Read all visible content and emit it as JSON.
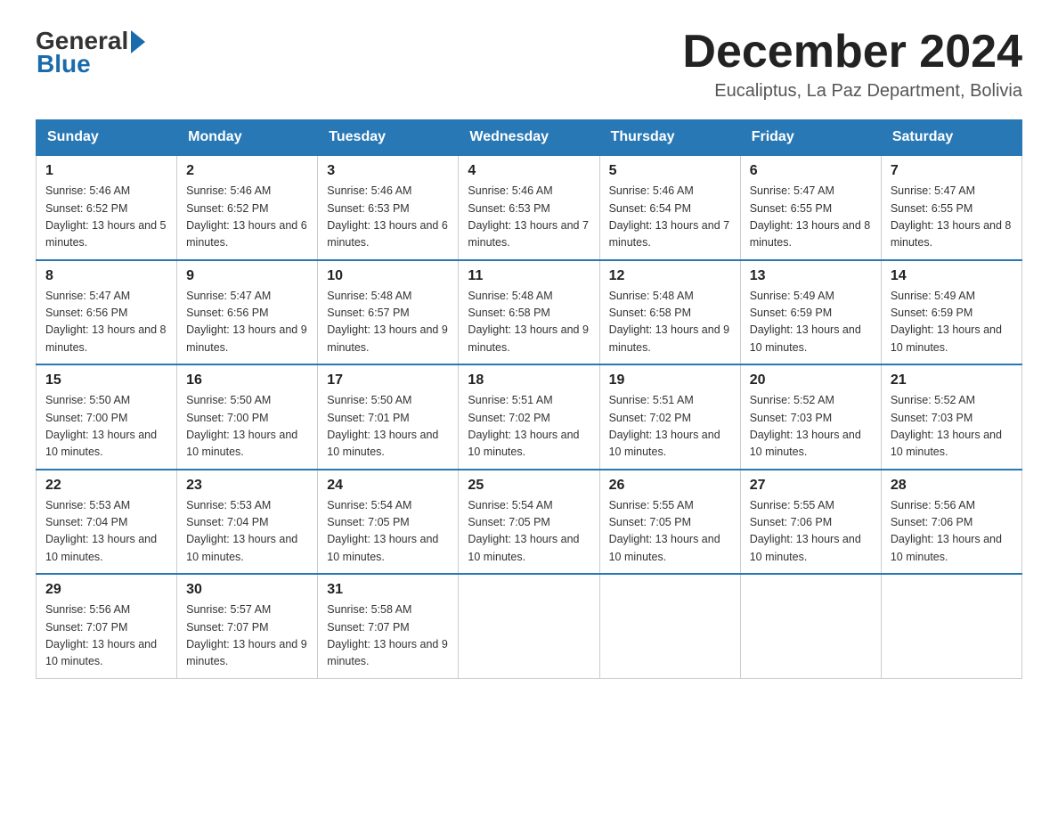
{
  "header": {
    "logo_general": "General",
    "logo_blue": "Blue",
    "month_title": "December 2024",
    "location": "Eucaliptus, La Paz Department, Bolivia"
  },
  "days_of_week": [
    "Sunday",
    "Monday",
    "Tuesday",
    "Wednesday",
    "Thursday",
    "Friday",
    "Saturday"
  ],
  "weeks": [
    [
      {
        "day": "1",
        "sunrise": "Sunrise: 5:46 AM",
        "sunset": "Sunset: 6:52 PM",
        "daylight": "Daylight: 13 hours and 5 minutes."
      },
      {
        "day": "2",
        "sunrise": "Sunrise: 5:46 AM",
        "sunset": "Sunset: 6:52 PM",
        "daylight": "Daylight: 13 hours and 6 minutes."
      },
      {
        "day": "3",
        "sunrise": "Sunrise: 5:46 AM",
        "sunset": "Sunset: 6:53 PM",
        "daylight": "Daylight: 13 hours and 6 minutes."
      },
      {
        "day": "4",
        "sunrise": "Sunrise: 5:46 AM",
        "sunset": "Sunset: 6:53 PM",
        "daylight": "Daylight: 13 hours and 7 minutes."
      },
      {
        "day": "5",
        "sunrise": "Sunrise: 5:46 AM",
        "sunset": "Sunset: 6:54 PM",
        "daylight": "Daylight: 13 hours and 7 minutes."
      },
      {
        "day": "6",
        "sunrise": "Sunrise: 5:47 AM",
        "sunset": "Sunset: 6:55 PM",
        "daylight": "Daylight: 13 hours and 8 minutes."
      },
      {
        "day": "7",
        "sunrise": "Sunrise: 5:47 AM",
        "sunset": "Sunset: 6:55 PM",
        "daylight": "Daylight: 13 hours and 8 minutes."
      }
    ],
    [
      {
        "day": "8",
        "sunrise": "Sunrise: 5:47 AM",
        "sunset": "Sunset: 6:56 PM",
        "daylight": "Daylight: 13 hours and 8 minutes."
      },
      {
        "day": "9",
        "sunrise": "Sunrise: 5:47 AM",
        "sunset": "Sunset: 6:56 PM",
        "daylight": "Daylight: 13 hours and 9 minutes."
      },
      {
        "day": "10",
        "sunrise": "Sunrise: 5:48 AM",
        "sunset": "Sunset: 6:57 PM",
        "daylight": "Daylight: 13 hours and 9 minutes."
      },
      {
        "day": "11",
        "sunrise": "Sunrise: 5:48 AM",
        "sunset": "Sunset: 6:58 PM",
        "daylight": "Daylight: 13 hours and 9 minutes."
      },
      {
        "day": "12",
        "sunrise": "Sunrise: 5:48 AM",
        "sunset": "Sunset: 6:58 PM",
        "daylight": "Daylight: 13 hours and 9 minutes."
      },
      {
        "day": "13",
        "sunrise": "Sunrise: 5:49 AM",
        "sunset": "Sunset: 6:59 PM",
        "daylight": "Daylight: 13 hours and 10 minutes."
      },
      {
        "day": "14",
        "sunrise": "Sunrise: 5:49 AM",
        "sunset": "Sunset: 6:59 PM",
        "daylight": "Daylight: 13 hours and 10 minutes."
      }
    ],
    [
      {
        "day": "15",
        "sunrise": "Sunrise: 5:50 AM",
        "sunset": "Sunset: 7:00 PM",
        "daylight": "Daylight: 13 hours and 10 minutes."
      },
      {
        "day": "16",
        "sunrise": "Sunrise: 5:50 AM",
        "sunset": "Sunset: 7:00 PM",
        "daylight": "Daylight: 13 hours and 10 minutes."
      },
      {
        "day": "17",
        "sunrise": "Sunrise: 5:50 AM",
        "sunset": "Sunset: 7:01 PM",
        "daylight": "Daylight: 13 hours and 10 minutes."
      },
      {
        "day": "18",
        "sunrise": "Sunrise: 5:51 AM",
        "sunset": "Sunset: 7:02 PM",
        "daylight": "Daylight: 13 hours and 10 minutes."
      },
      {
        "day": "19",
        "sunrise": "Sunrise: 5:51 AM",
        "sunset": "Sunset: 7:02 PM",
        "daylight": "Daylight: 13 hours and 10 minutes."
      },
      {
        "day": "20",
        "sunrise": "Sunrise: 5:52 AM",
        "sunset": "Sunset: 7:03 PM",
        "daylight": "Daylight: 13 hours and 10 minutes."
      },
      {
        "day": "21",
        "sunrise": "Sunrise: 5:52 AM",
        "sunset": "Sunset: 7:03 PM",
        "daylight": "Daylight: 13 hours and 10 minutes."
      }
    ],
    [
      {
        "day": "22",
        "sunrise": "Sunrise: 5:53 AM",
        "sunset": "Sunset: 7:04 PM",
        "daylight": "Daylight: 13 hours and 10 minutes."
      },
      {
        "day": "23",
        "sunrise": "Sunrise: 5:53 AM",
        "sunset": "Sunset: 7:04 PM",
        "daylight": "Daylight: 13 hours and 10 minutes."
      },
      {
        "day": "24",
        "sunrise": "Sunrise: 5:54 AM",
        "sunset": "Sunset: 7:05 PM",
        "daylight": "Daylight: 13 hours and 10 minutes."
      },
      {
        "day": "25",
        "sunrise": "Sunrise: 5:54 AM",
        "sunset": "Sunset: 7:05 PM",
        "daylight": "Daylight: 13 hours and 10 minutes."
      },
      {
        "day": "26",
        "sunrise": "Sunrise: 5:55 AM",
        "sunset": "Sunset: 7:05 PM",
        "daylight": "Daylight: 13 hours and 10 minutes."
      },
      {
        "day": "27",
        "sunrise": "Sunrise: 5:55 AM",
        "sunset": "Sunset: 7:06 PM",
        "daylight": "Daylight: 13 hours and 10 minutes."
      },
      {
        "day": "28",
        "sunrise": "Sunrise: 5:56 AM",
        "sunset": "Sunset: 7:06 PM",
        "daylight": "Daylight: 13 hours and 10 minutes."
      }
    ],
    [
      {
        "day": "29",
        "sunrise": "Sunrise: 5:56 AM",
        "sunset": "Sunset: 7:07 PM",
        "daylight": "Daylight: 13 hours and 10 minutes."
      },
      {
        "day": "30",
        "sunrise": "Sunrise: 5:57 AM",
        "sunset": "Sunset: 7:07 PM",
        "daylight": "Daylight: 13 hours and 9 minutes."
      },
      {
        "day": "31",
        "sunrise": "Sunrise: 5:58 AM",
        "sunset": "Sunset: 7:07 PM",
        "daylight": "Daylight: 13 hours and 9 minutes."
      },
      null,
      null,
      null,
      null
    ]
  ]
}
